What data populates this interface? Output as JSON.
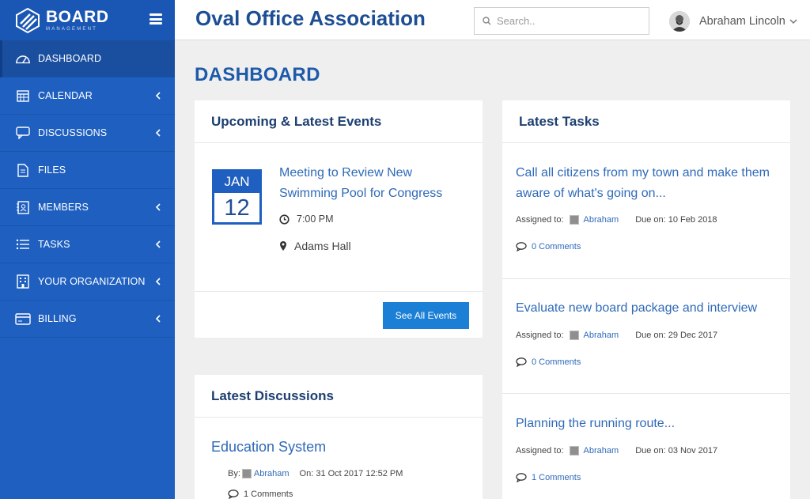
{
  "brand": {
    "title": "BOARD",
    "subtitle": "MANAGEMENT"
  },
  "sidebar": {
    "items": [
      {
        "label": "DASHBOARD",
        "icon": "gauge-icon",
        "active": true
      },
      {
        "label": "CALENDAR",
        "icon": "calendar-icon"
      },
      {
        "label": "DISCUSSIONS",
        "icon": "chat-icon"
      },
      {
        "label": "FILES",
        "icon": "file-icon"
      },
      {
        "label": "MEMBERS",
        "icon": "contacts-icon"
      },
      {
        "label": "TASKS",
        "icon": "list-icon"
      },
      {
        "label": "YOUR ORGANIZATION",
        "icon": "building-icon"
      },
      {
        "label": "BILLING",
        "icon": "credit-card-icon"
      }
    ]
  },
  "header": {
    "org_title": "Oval Office Association",
    "search_placeholder": "Search..",
    "user_name": "Abraham Lincoln"
  },
  "page": {
    "title": "DASHBOARD"
  },
  "events": {
    "heading": "Upcoming & Latest Events",
    "month": "JAN",
    "day": "12",
    "title": "Meeting to Review New Swimming Pool for Congress",
    "time": "7:00 PM",
    "location": "Adams Hall",
    "button": "See All Events"
  },
  "discussions": {
    "heading": "Latest Discussions",
    "title": "Education System",
    "by_label": "By:",
    "author": "Abraham",
    "on_label": "On: 31 Oct 2017 12:52 PM",
    "comments": "1 Comments"
  },
  "tasks": {
    "heading": "Latest Tasks",
    "items": [
      {
        "title": "Call all citizens from my town and make them aware of what's going on...",
        "assigned_label": "Assigned to:",
        "assignee": "Abraham",
        "due": "Due on: 10 Feb 2018",
        "comments": "0 Comments"
      },
      {
        "title": "Evaluate new board package and interview",
        "assigned_label": "Assigned to:",
        "assignee": "Abraham",
        "due": "Due on: 29 Dec 2017",
        "comments": "0 Comments"
      },
      {
        "title": "Planning the running route...",
        "assigned_label": "Assigned to:",
        "assignee": "Abraham",
        "due": "Due on: 03 Nov 2017",
        "comments": "1 Comments"
      }
    ]
  },
  "colors": {
    "sidebar": "#1e5fc0",
    "accent": "#1b7fd6",
    "link": "#2f6ab8",
    "title": "#1d4e94"
  }
}
